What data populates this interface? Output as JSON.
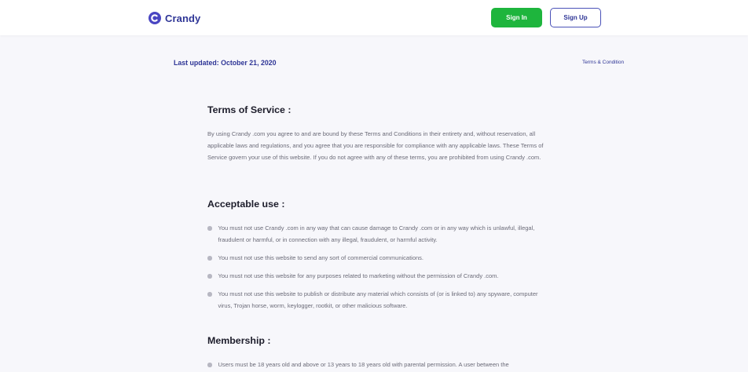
{
  "header": {
    "brand_name": "Crandy",
    "sign_in_label": "Sign In",
    "sign_up_label": "Sign Up"
  },
  "meta": {
    "last_updated": "Last updated: October 21, 2020",
    "breadcrumb": "Terms & Condition"
  },
  "colors": {
    "brand": "#2e3596",
    "sign_in_bg": "#1eb53d",
    "page_bg": "#f7f7fb"
  },
  "sections": {
    "terms": {
      "title": "Terms of Service :",
      "body": "By using Crandy .com you agree to and are bound by these Terms and Conditions in their entirety and, without reservation, all applicable laws and regulations, and you agree that you are responsible for compliance with any applicable laws. These Terms of Service govern your use of this website. If you do not agree with any of these terms, you are prohibited from using Crandy .com."
    },
    "acceptable_use": {
      "title": "Acceptable use :",
      "items": [
        "You must not use Crandy .com in any way that can cause damage to Crandy .com or in any way which is unlawful, illegal, fraudulent or harmful, or in connection with any illegal, fraudulent, or harmful activity.",
        "You must not use this website to send any sort of commercial communications.",
        "You must not use this website for any purposes related to marketing without the permission of Crandy .com.",
        "You must not use this website to publish or distribute any material which consists of (or is linked to) any spyware, computer virus, Trojan horse, worm, keylogger, rootkit, or other malicious software."
      ]
    },
    "membership": {
      "title": "Membership :",
      "items": [
        "Users must be 18 years old and above or 13 years to 18 years old with parental permission. A user between the"
      ]
    }
  }
}
